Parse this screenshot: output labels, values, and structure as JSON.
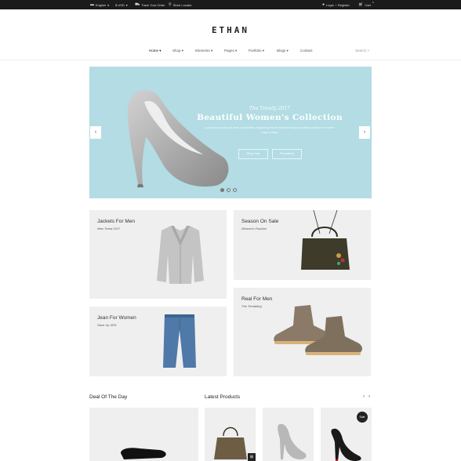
{
  "topbar": {
    "language": "English",
    "currency": "$ USD",
    "track": "Track Your Order",
    "store": "Store Locator",
    "login": "Login",
    "separator": "/",
    "register": "Register",
    "cart": "Cart",
    "cart_count": "0"
  },
  "logo": "ETHAN",
  "nav": {
    "items": [
      {
        "label": "Home",
        "active": true
      },
      {
        "label": "Shop"
      },
      {
        "label": "Elements"
      },
      {
        "label": "Pages"
      },
      {
        "label": "Portfolio"
      },
      {
        "label": "Blogs"
      },
      {
        "label": "Contact"
      }
    ],
    "search_placeholder": "Search"
  },
  "hero": {
    "subtitle": "The Trendy 2017",
    "title": "Beautiful Women's Collection",
    "description": "Lorem ipsum dolor sit amet, consectetur adipisicing elit do eiusmod tempor incididunt ut labore et dolore magna aliqua",
    "btn_shop": "Shop Now",
    "btn_promotion": "Promotions",
    "slide_index": 1,
    "slide_count": 3
  },
  "banners": [
    {
      "title": "Jackets For Men",
      "subtitle": "New Trend 2017"
    },
    {
      "title": "Season On Sale",
      "subtitle": "Women's Fashion"
    },
    {
      "title": "Jean For Women",
      "subtitle": "Save Up 30%"
    },
    {
      "title": "Real For Men",
      "subtitle": "The Trendding"
    }
  ],
  "deal": {
    "title": "Deal Of The Day"
  },
  "latest": {
    "title": "Latest Products",
    "prev": "‹",
    "next": "›"
  },
  "badge": "Sale",
  "colors": {
    "topbar": "#1b1b1b",
    "hero_bg": "#b3dce4",
    "banner_bg": "#efefef"
  }
}
